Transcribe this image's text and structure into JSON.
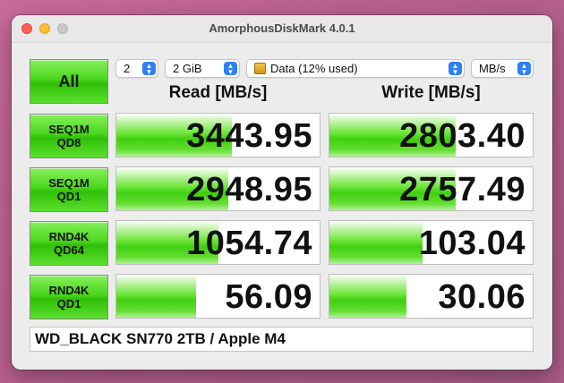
{
  "window": {
    "title": "AmorphousDiskMark 4.0.1"
  },
  "controls": {
    "all_label": "All",
    "count": "2",
    "size": "2 GiB",
    "target": "Data (12% used)",
    "unit": "MB/s"
  },
  "headers": {
    "read": "Read [MB/s]",
    "write": "Write [MB/s]"
  },
  "rows": [
    {
      "line1": "SEQ1M",
      "line2": "QD8",
      "read": "3443.95",
      "write": "2803.40",
      "read_fill": 0.57,
      "write_fill": 0.62
    },
    {
      "line1": "SEQ1M",
      "line2": "QD1",
      "read": "2948.95",
      "write": "2757.49",
      "read_fill": 0.55,
      "write_fill": 0.62
    },
    {
      "line1": "RND4K",
      "line2": "QD64",
      "read": "1054.74",
      "write": "103.04",
      "read_fill": 0.5,
      "write_fill": 0.46
    },
    {
      "line1": "RND4K",
      "line2": "QD1",
      "read": "56.09",
      "write": "30.06",
      "read_fill": 0.39,
      "write_fill": 0.38
    }
  ],
  "comment": "WD_BLACK SN770 2TB / Apple M4",
  "colors": {
    "accent": "#2f7ff7",
    "bar_green": "#3fcf10",
    "button_green": "#4ad61c"
  }
}
